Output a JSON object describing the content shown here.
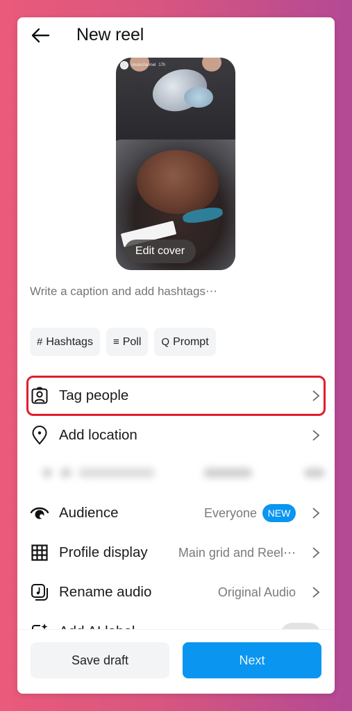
{
  "header": {
    "title": "New reel",
    "back_icon": "arrow-left"
  },
  "cover": {
    "story_username": "steakchannel",
    "story_time": "17h",
    "edit_cover_label": "Edit cover"
  },
  "caption": {
    "placeholder": "Write a caption and add hashtags⋯",
    "value": ""
  },
  "chips": [
    {
      "icon": "#",
      "label": "Hashtags"
    },
    {
      "icon": "≡",
      "label": "Poll"
    },
    {
      "icon": "Q",
      "label": "Prompt"
    }
  ],
  "options": {
    "tag_people": {
      "label": "Tag people",
      "icon": "tag-person-icon"
    },
    "add_location": {
      "label": "Add location",
      "icon": "location-pin-icon"
    },
    "audience": {
      "label": "Audience",
      "value": "Everyone",
      "badge": "NEW",
      "icon": "eye-icon"
    },
    "profile_display": {
      "label": "Profile display",
      "value": "Main grid and Reel⋯",
      "icon": "grid-icon"
    },
    "rename_audio": {
      "label": "Rename audio",
      "value": "Original Audio",
      "icon": "audio-note-icon"
    },
    "ai_label": {
      "label": "Add AI label",
      "icon": "ai-sparkle-icon",
      "toggle_on": false
    }
  },
  "footer": {
    "save_draft_label": "Save draft",
    "next_label": "Next"
  },
  "colors": {
    "accent": "#0a95f0",
    "highlight": "#e11d2a",
    "background_left": "#ea5a7b",
    "background_right": "#b34995"
  }
}
